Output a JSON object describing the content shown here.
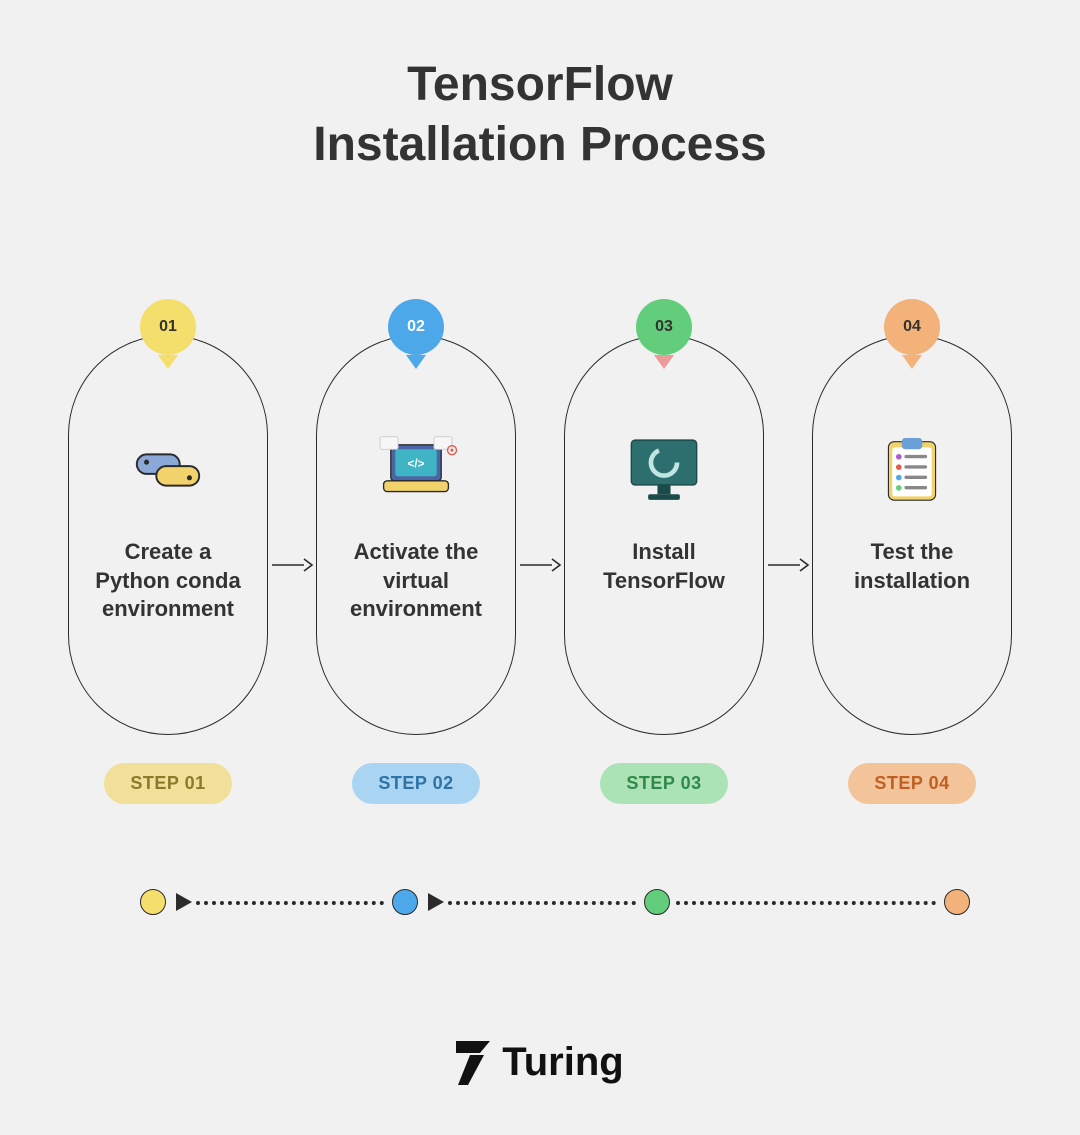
{
  "title_line1": "TensorFlow",
  "title_line2": "Installation Process",
  "steps": [
    {
      "num": "01",
      "label": "Create a Python conda environment",
      "pill": "STEP 01",
      "color": "yellow",
      "icon": "python-icon"
    },
    {
      "num": "02",
      "label": "Activate the virtual environment",
      "pill": "STEP 02",
      "color": "blue",
      "icon": "laptop-code-icon"
    },
    {
      "num": "03",
      "label": "Install TensorFlow",
      "pill": "STEP 03",
      "color": "green",
      "icon": "monitor-progress-icon"
    },
    {
      "num": "04",
      "label": "Test the installation",
      "pill": "STEP 04",
      "color": "orange",
      "icon": "checklist-icon"
    }
  ],
  "brand": "Turing",
  "colors": {
    "yellow": "#f4de6c",
    "blue": "#4ca8e8",
    "green": "#62ce7b",
    "orange": "#f3b279"
  }
}
